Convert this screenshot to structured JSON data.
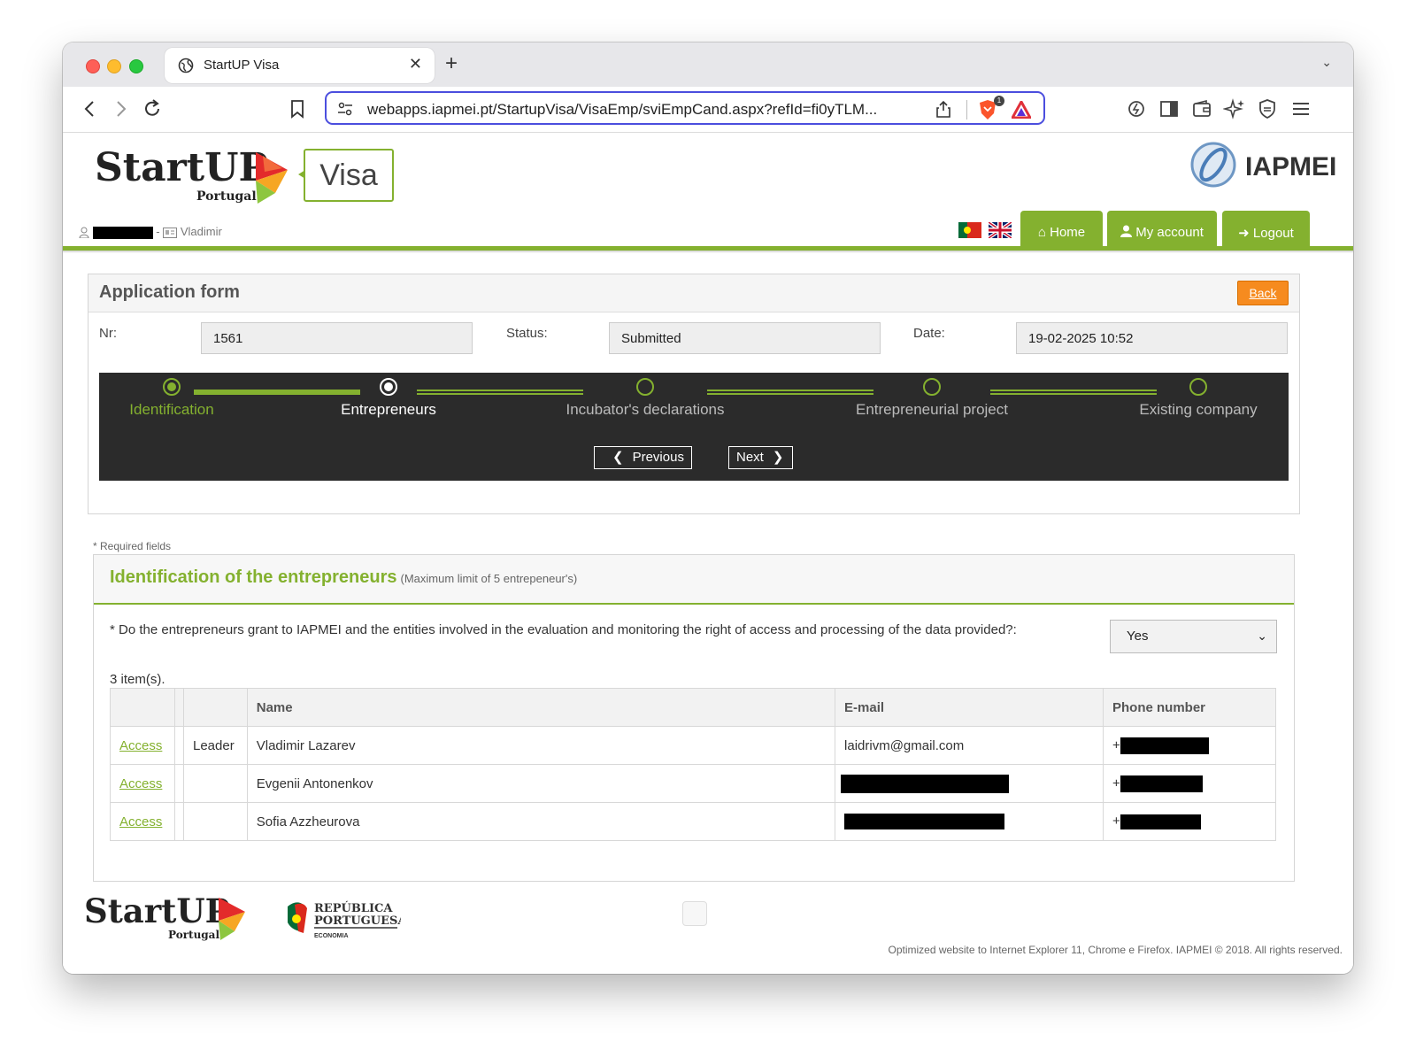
{
  "browser": {
    "tab_title": "StartUP Visa",
    "tab_close": "✕",
    "new_tab": "+",
    "url": "webapps.iapmei.pt/StartupVisa/VisaEmp/sviEmpCand.aspx?refId=fi0yTLM...",
    "shields_badge": "1"
  },
  "header": {
    "logo_main": "StartUP",
    "logo_sub": "Portugal",
    "visa_label": "Visa",
    "iapmei_label": "IAPMEI",
    "user_separator": "-",
    "user_name": "Vladimir",
    "nav": {
      "home": "Home",
      "my_account": "My account",
      "logout": "Logout"
    }
  },
  "form": {
    "title": "Application form",
    "back": "Back",
    "nr_label": "Nr:",
    "nr_value": "1561",
    "status_label": "Status:",
    "status_value": "Submitted",
    "date_label": "Date:",
    "date_value": "19-02-2025 10:52"
  },
  "wizard": {
    "steps": [
      {
        "label": "Identification",
        "state": "done"
      },
      {
        "label": "Entrepreneurs",
        "state": "current"
      },
      {
        "label": "Incubator's declarations",
        "state": "todo"
      },
      {
        "label": "Entrepreneurial project",
        "state": "todo"
      },
      {
        "label": "Existing company",
        "state": "todo"
      }
    ],
    "previous": "Previous",
    "next": "Next"
  },
  "entrepreneurs": {
    "required_note": "* Required fields",
    "title": "Identification of the entrepreneurs",
    "subtitle": "(Maximum limit of 5 entrepeneur's)",
    "question": "* Do the entrepreneurs grant to IAPMEI and the entities involved in the evaluation and monitoring the right of access and processing of the data provided?:",
    "answer": "Yes",
    "item_count": "3 item(s).",
    "columns": [
      "",
      "",
      "",
      "Name",
      "E-mail",
      "Phone number"
    ],
    "rows": [
      {
        "action": "Access",
        "role": "Leader",
        "name": "Vladimir Lazarev",
        "email": "laidrivm@gmail.com",
        "phone_prefix": "+"
      },
      {
        "action": "Access",
        "role": "",
        "name": "Evgenii Antonenkov",
        "email": "",
        "phone_prefix": "+"
      },
      {
        "action": "Access",
        "role": "",
        "name": "Sofia Azzheurova",
        "email": "",
        "phone_prefix": "+"
      }
    ]
  },
  "footer": {
    "logo_main": "StartUP",
    "logo_sub": "Portugal",
    "republica_line1": "REPÚBLICA",
    "republica_line2": "PORTUGUESA",
    "republica_line3": "ECONOMIA",
    "note": "Optimized website to Internet Explorer 11, Chrome e Firefox. IAPMEI © 2018. All rights reserved."
  },
  "colors": {
    "brand_green": "#84b12f",
    "back_orange": "#f68b1f",
    "wizard_bg": "#2b2b2b",
    "url_focus": "#4b4ede"
  }
}
